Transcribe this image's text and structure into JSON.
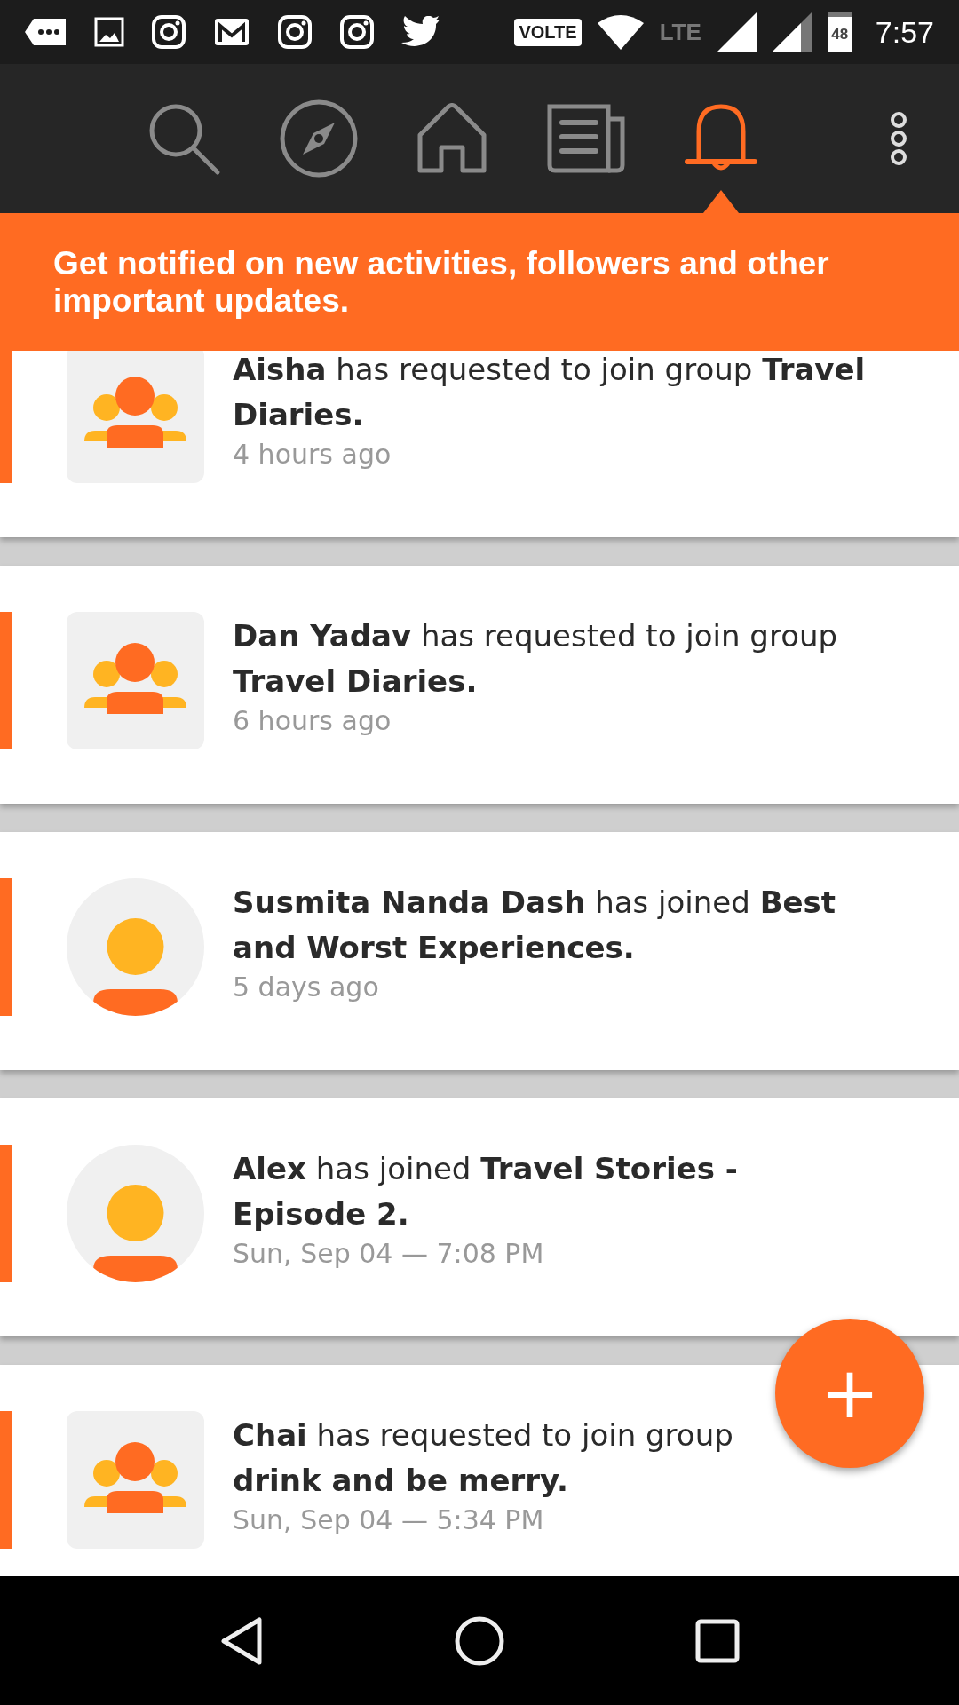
{
  "status_bar": {
    "volte": "VOLTE",
    "network": "LTE",
    "battery": "48",
    "time": "7:57"
  },
  "nav_tabs": [
    {
      "kind": "search",
      "selected": false
    },
    {
      "kind": "explore",
      "selected": false
    },
    {
      "kind": "home",
      "selected": false
    },
    {
      "kind": "feed",
      "selected": false
    },
    {
      "kind": "notifications",
      "selected": true
    }
  ],
  "banner": {
    "text": "Get notified on new activities, followers and other important updates."
  },
  "notifications": [
    {
      "kind": "group",
      "unread": true,
      "text": "**Aisha** has requested to join group **Travel Diaries.**",
      "time": "4 hours ago"
    },
    {
      "kind": "group",
      "unread": true,
      "text": "**Dan Yadav** has requested to join group **Travel Diaries.**",
      "time": "6 hours ago"
    },
    {
      "kind": "person",
      "unread": true,
      "text": "**Susmita Nanda Dash** has joined **Best and Worst Experiences.**",
      "time": "5 days ago"
    },
    {
      "kind": "person",
      "unread": true,
      "text": "**Alex** has joined **Travel Stories - Episode 2.**",
      "time": "Sun, Sep 04 — 7:08 PM"
    },
    {
      "kind": "group",
      "unread": true,
      "text": "**Chai** has requested to join group **drink and be merry.**",
      "time": "Sun, Sep 04 — 5:34 PM"
    }
  ],
  "fab": {
    "label": "+"
  }
}
